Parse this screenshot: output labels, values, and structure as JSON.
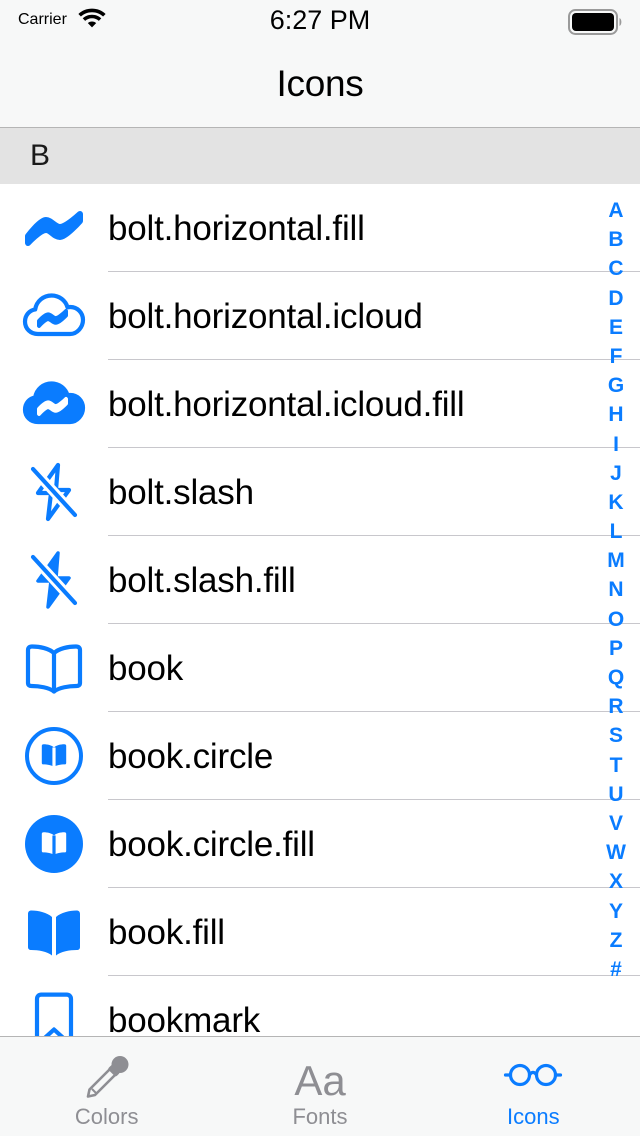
{
  "status_bar": {
    "carrier": "Carrier",
    "wifi_icon": "wifi-icon",
    "time": "6:27 PM",
    "battery_icon": "battery-full-icon"
  },
  "nav_bar": {
    "title": "Icons"
  },
  "section": {
    "header": "B"
  },
  "colors": {
    "accent": "#0a7cff",
    "separator": "#c8c7cc",
    "section_header_bg": "#e3e3e3",
    "bar_bg": "#f7f8f8",
    "inactive_tab": "#8e8e93"
  },
  "list": {
    "rows": [
      {
        "icon": "bolt-horizontal-fill-icon",
        "label": "bolt.horizontal.fill"
      },
      {
        "icon": "bolt-horizontal-icloud-icon",
        "label": "bolt.horizontal.icloud"
      },
      {
        "icon": "bolt-horizontal-icloud-fill-icon",
        "label": "bolt.horizontal.icloud.fill"
      },
      {
        "icon": "bolt-slash-icon",
        "label": "bolt.slash"
      },
      {
        "icon": "bolt-slash-fill-icon",
        "label": "bolt.slash.fill"
      },
      {
        "icon": "book-icon",
        "label": "book"
      },
      {
        "icon": "book-circle-icon",
        "label": "book.circle"
      },
      {
        "icon": "book-circle-fill-icon",
        "label": "book.circle.fill"
      },
      {
        "icon": "book-fill-icon",
        "label": "book.fill"
      },
      {
        "icon": "bookmark-icon",
        "label": "bookmark"
      }
    ]
  },
  "index_bar": {
    "letters": [
      "A",
      "B",
      "C",
      "D",
      "E",
      "F",
      "G",
      "H",
      "I",
      "J",
      "K",
      "L",
      "M",
      "N",
      "O",
      "P",
      "Q",
      "R",
      "S",
      "T",
      "U",
      "V",
      "W",
      "X",
      "Y",
      "Z",
      "#"
    ]
  },
  "tab_bar": {
    "tabs": [
      {
        "label": "Colors",
        "icon": "eyedropper-icon",
        "active": false
      },
      {
        "label": "Fonts",
        "icon": "text-aa-icon",
        "active": false
      },
      {
        "label": "Icons",
        "icon": "eyeglasses-icon",
        "active": true
      }
    ]
  }
}
